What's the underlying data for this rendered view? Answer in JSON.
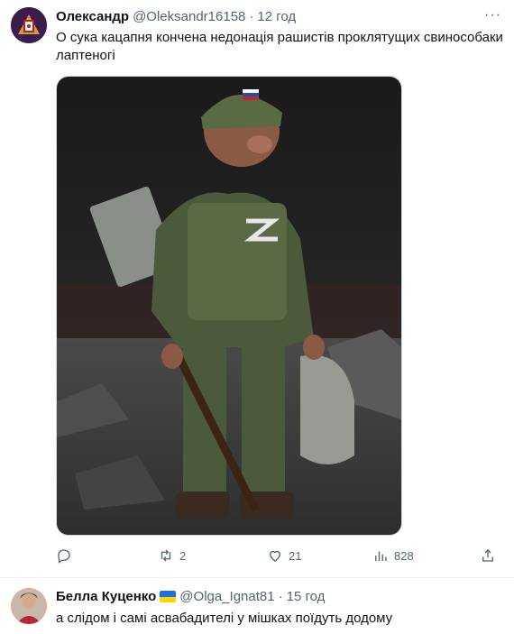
{
  "tweet": {
    "author": {
      "name": "Олександр",
      "handle": "@Oleksandr16158"
    },
    "dot": "·",
    "time": "12 год",
    "text": "О сука кацапня кончена недонація рашистів проклятущих свинособаки лаптеногі",
    "media": {
      "icon": "photo",
      "description_icon": "image-media",
      "flag_patch": "russian-flag",
      "chest_letter": "Z"
    },
    "more_icon": "more-dots-icon",
    "actions": {
      "reply": {
        "icon": "reply-icon",
        "count": ""
      },
      "retweet": {
        "icon": "retweet-icon",
        "count": "2"
      },
      "like": {
        "icon": "heart-icon",
        "count": "21"
      },
      "views": {
        "icon": "views-icon",
        "count": "828"
      },
      "share": {
        "icon": "share-icon",
        "count": ""
      }
    }
  },
  "reply": {
    "author": {
      "name": "Белла Куценко",
      "handle": "@Olga_Ignat81",
      "flag": "ukraine-flag"
    },
    "dot": "·",
    "time": "15 год",
    "text": "а слідом і самі асвабадителі у мішках поїдуть додому"
  },
  "colors": {
    "text": "#0f1419",
    "secondary": "#536471",
    "divider": "#eff3f4",
    "ukraine_blue": "#1d6fe8",
    "ukraine_yellow": "#ffd500"
  }
}
